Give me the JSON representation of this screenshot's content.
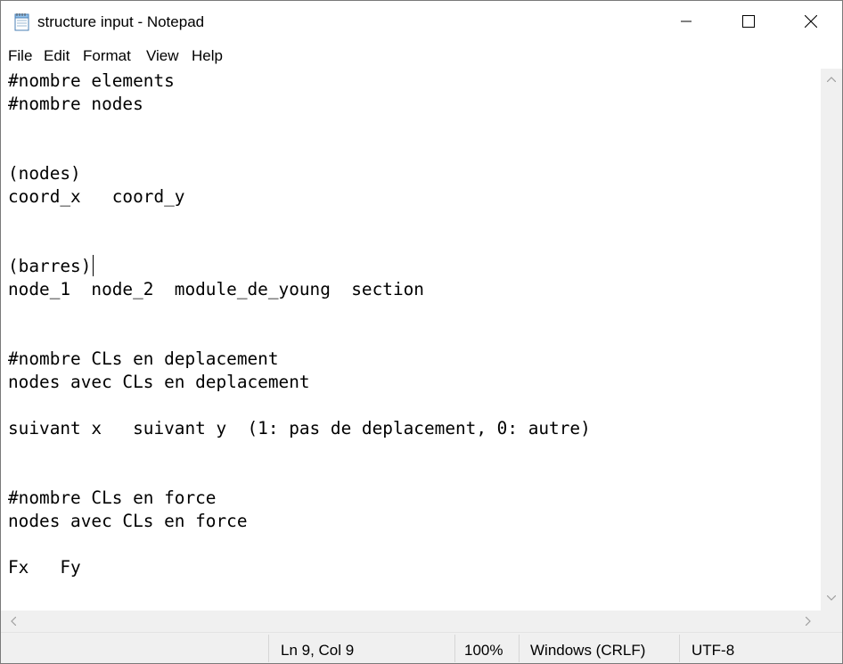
{
  "window": {
    "title": "structure input - Notepad",
    "controls": {
      "minimize": "minimize-icon",
      "maximize": "maximize-icon",
      "close": "close-icon"
    }
  },
  "menu": {
    "file": "File",
    "edit": "Edit",
    "format": "Format",
    "view": "View",
    "help": "Help"
  },
  "editor": {
    "text": "#nombre elements\n#nombre nodes\n\n\n(nodes)\ncoord_x   coord_y\n\n\n(barres)\nnode_1  node_2  module_de_young  section\n\n\n#nombre CLs en deplacement\nnodes avec CLs en deplacement\n\nsuivant x   suivant y  (1: pas de deplacement, 0: autre)\n\n\n#nombre CLs en force\nnodes avec CLs en force\n\nFx   Fy"
  },
  "status": {
    "position": "Ln 9, Col 9",
    "zoom": "100%",
    "line_ending": "Windows (CRLF)",
    "encoding": "UTF-8"
  },
  "colors": {
    "chrome": "#f0f0f0",
    "text": "#000000",
    "background": "#ffffff"
  }
}
